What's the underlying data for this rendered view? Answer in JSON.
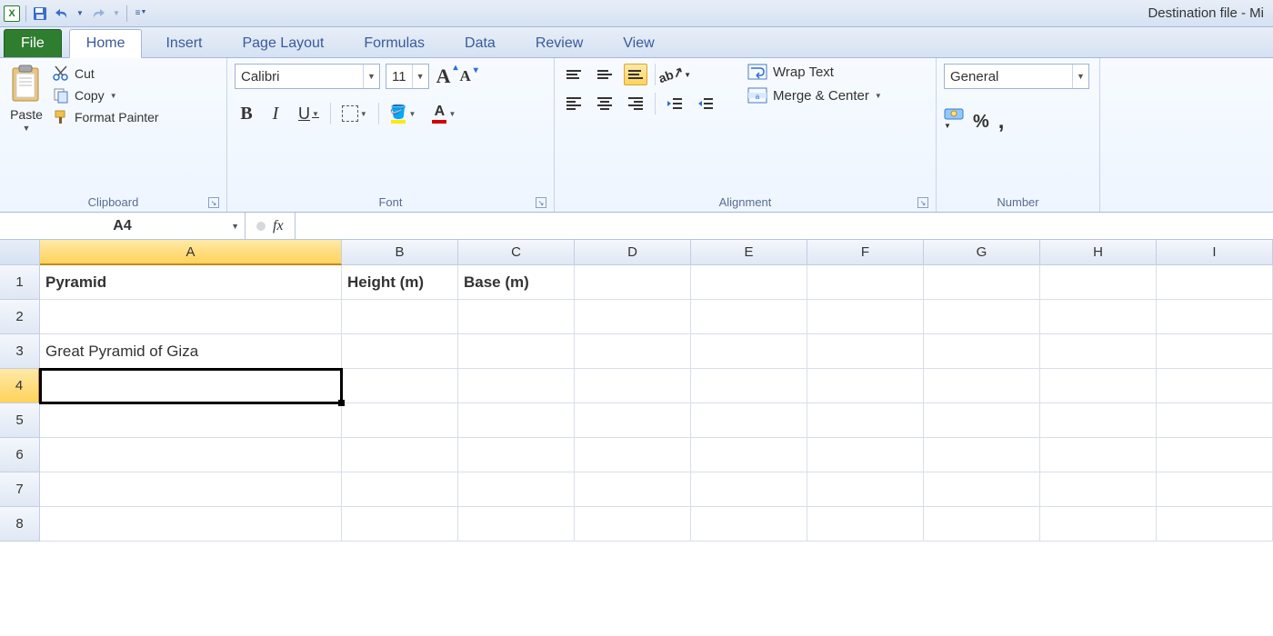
{
  "app": {
    "title": "Destination file  -  Mi"
  },
  "qat": {
    "save": "save",
    "undo": "undo",
    "redo": "redo"
  },
  "tabs": {
    "file": "File",
    "items": [
      "Home",
      "Insert",
      "Page Layout",
      "Formulas",
      "Data",
      "Review",
      "View"
    ],
    "active": "Home"
  },
  "ribbon": {
    "clipboard": {
      "label": "Clipboard",
      "paste": "Paste",
      "cut": "Cut",
      "copy": "Copy",
      "format_painter": "Format Painter"
    },
    "font": {
      "label": "Font",
      "name": "Calibri",
      "size": "11",
      "grow": "A",
      "shrink": "A",
      "bold": "B",
      "italic": "I",
      "underline": "U",
      "fontcolor_letter": "A"
    },
    "alignment": {
      "label": "Alignment",
      "wrap": "Wrap Text",
      "merge": "Merge & Center"
    },
    "number": {
      "label": "Number",
      "format": "General",
      "percent": "%",
      "comma": ","
    }
  },
  "formula_bar": {
    "name_box": "A4",
    "fx": "fx",
    "value": ""
  },
  "grid": {
    "columns": [
      "A",
      "B",
      "C",
      "D",
      "E",
      "F",
      "G",
      "H",
      "I"
    ],
    "rows": [
      "1",
      "2",
      "3",
      "4",
      "5",
      "6",
      "7",
      "8"
    ],
    "active_col": "A",
    "active_row": "4",
    "cells": {
      "A1": "Pyramid",
      "B1": "Height (m)",
      "C1": "Base (m)",
      "A3": "Great Pyramid of Giza"
    },
    "bold_cells": [
      "A1",
      "B1",
      "C1"
    ],
    "selected": "A4"
  }
}
